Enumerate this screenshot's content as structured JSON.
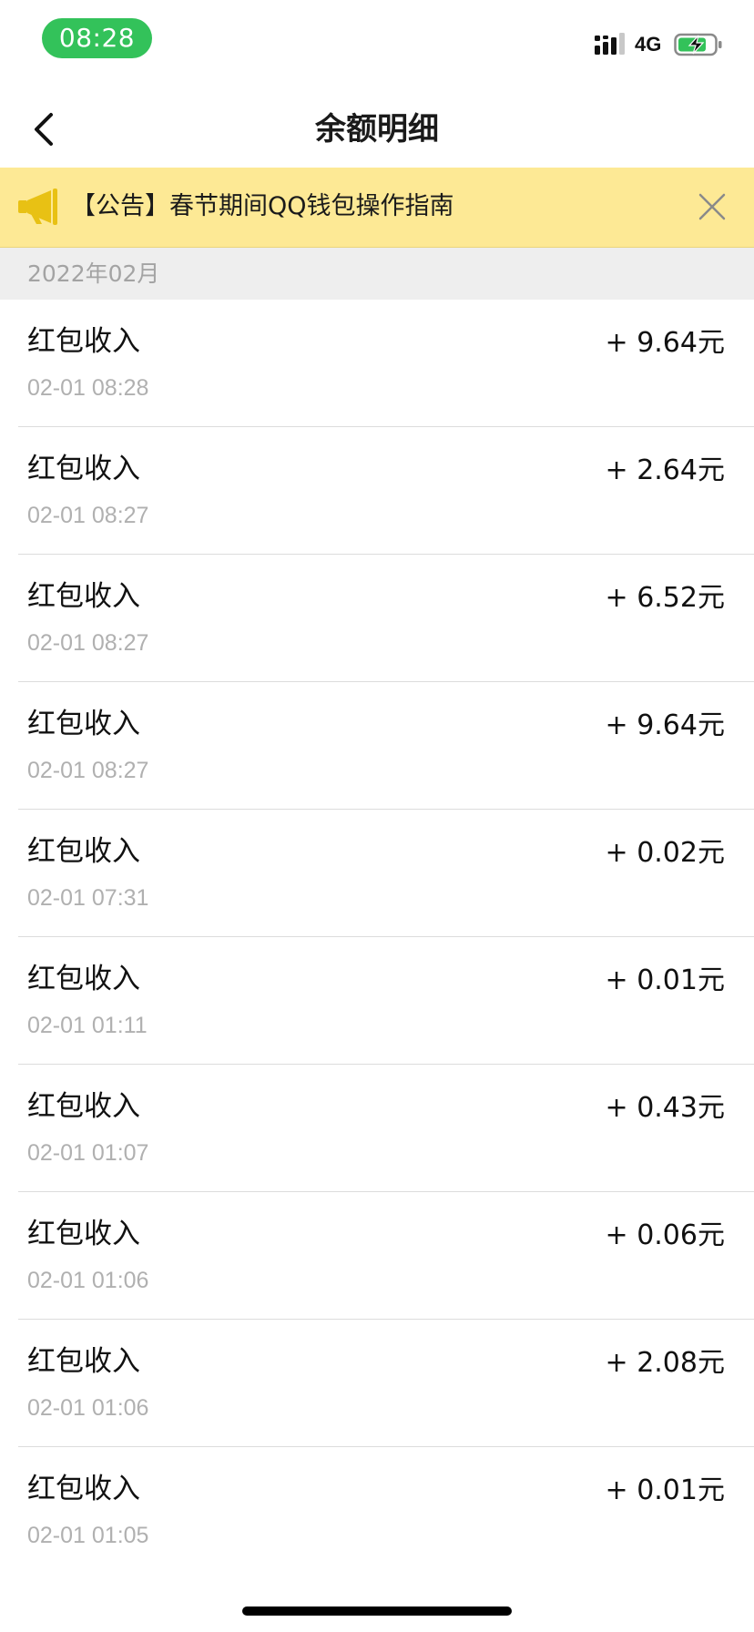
{
  "status_bar": {
    "time": "08:28",
    "network": "4G",
    "signal_icon": "signal-bars-icon",
    "battery_icon": "battery-charging-icon",
    "time_pill_color": "#33c25a"
  },
  "nav": {
    "back_icon": "chevron-left-icon",
    "title": "余额明细"
  },
  "announcement": {
    "icon": "megaphone-icon",
    "text": "【公告】春节期间QQ钱包操作指南",
    "close_icon": "close-icon",
    "background": "#fde995"
  },
  "month": {
    "label": "2022年02月"
  },
  "records": [
    {
      "title": "红包收入",
      "time": "02-01 08:28",
      "amount": "+ 9.64元"
    },
    {
      "title": "红包收入",
      "time": "02-01 08:27",
      "amount": "+ 2.64元"
    },
    {
      "title": "红包收入",
      "time": "02-01 08:27",
      "amount": "+ 6.52元"
    },
    {
      "title": "红包收入",
      "time": "02-01 08:27",
      "amount": "+ 9.64元"
    },
    {
      "title": "红包收入",
      "time": "02-01 07:31",
      "amount": "+ 0.02元"
    },
    {
      "title": "红包收入",
      "time": "02-01 01:11",
      "amount": "+ 0.01元"
    },
    {
      "title": "红包收入",
      "time": "02-01 01:07",
      "amount": "+ 0.43元"
    },
    {
      "title": "红包收入",
      "time": "02-01 01:06",
      "amount": "+ 0.06元"
    },
    {
      "title": "红包收入",
      "time": "02-01 01:06",
      "amount": "+ 2.08元"
    },
    {
      "title": "红包收入",
      "time": "02-01 01:05",
      "amount": "+ 0.01元"
    }
  ]
}
